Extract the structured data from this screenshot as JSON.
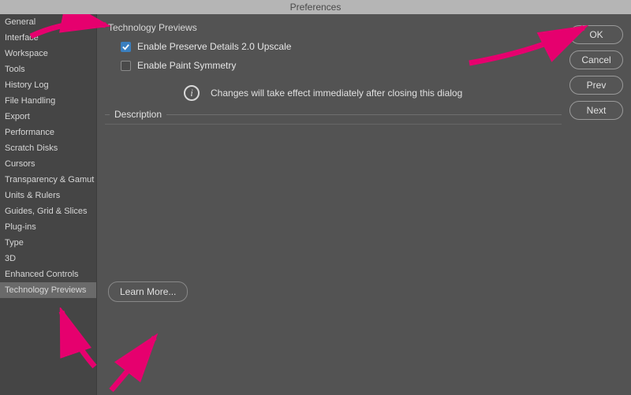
{
  "window": {
    "title": "Preferences"
  },
  "sidebar": {
    "items": [
      {
        "label": "General"
      },
      {
        "label": "Interface"
      },
      {
        "label": "Workspace"
      },
      {
        "label": "Tools"
      },
      {
        "label": "History Log"
      },
      {
        "label": "File Handling"
      },
      {
        "label": "Export"
      },
      {
        "label": "Performance"
      },
      {
        "label": "Scratch Disks"
      },
      {
        "label": "Cursors"
      },
      {
        "label": "Transparency & Gamut"
      },
      {
        "label": "Units & Rulers"
      },
      {
        "label": "Guides, Grid & Slices"
      },
      {
        "label": "Plug-ins"
      },
      {
        "label": "Type"
      },
      {
        "label": "3D"
      },
      {
        "label": "Enhanced Controls"
      },
      {
        "label": "Technology Previews"
      }
    ],
    "selected_index": 17
  },
  "panel": {
    "title": "Technology Previews",
    "options": [
      {
        "label": "Enable Preserve Details 2.0 Upscale",
        "checked": true
      },
      {
        "label": "Enable Paint Symmetry",
        "checked": false
      }
    ],
    "notice": "Changes will take effect immediately after closing this dialog",
    "description_label": "Description",
    "learn_more_label": "Learn More..."
  },
  "buttons": {
    "ok": "OK",
    "cancel": "Cancel",
    "prev": "Prev",
    "next": "Next"
  },
  "annotation": {
    "arrow_color": "#e6006e"
  }
}
